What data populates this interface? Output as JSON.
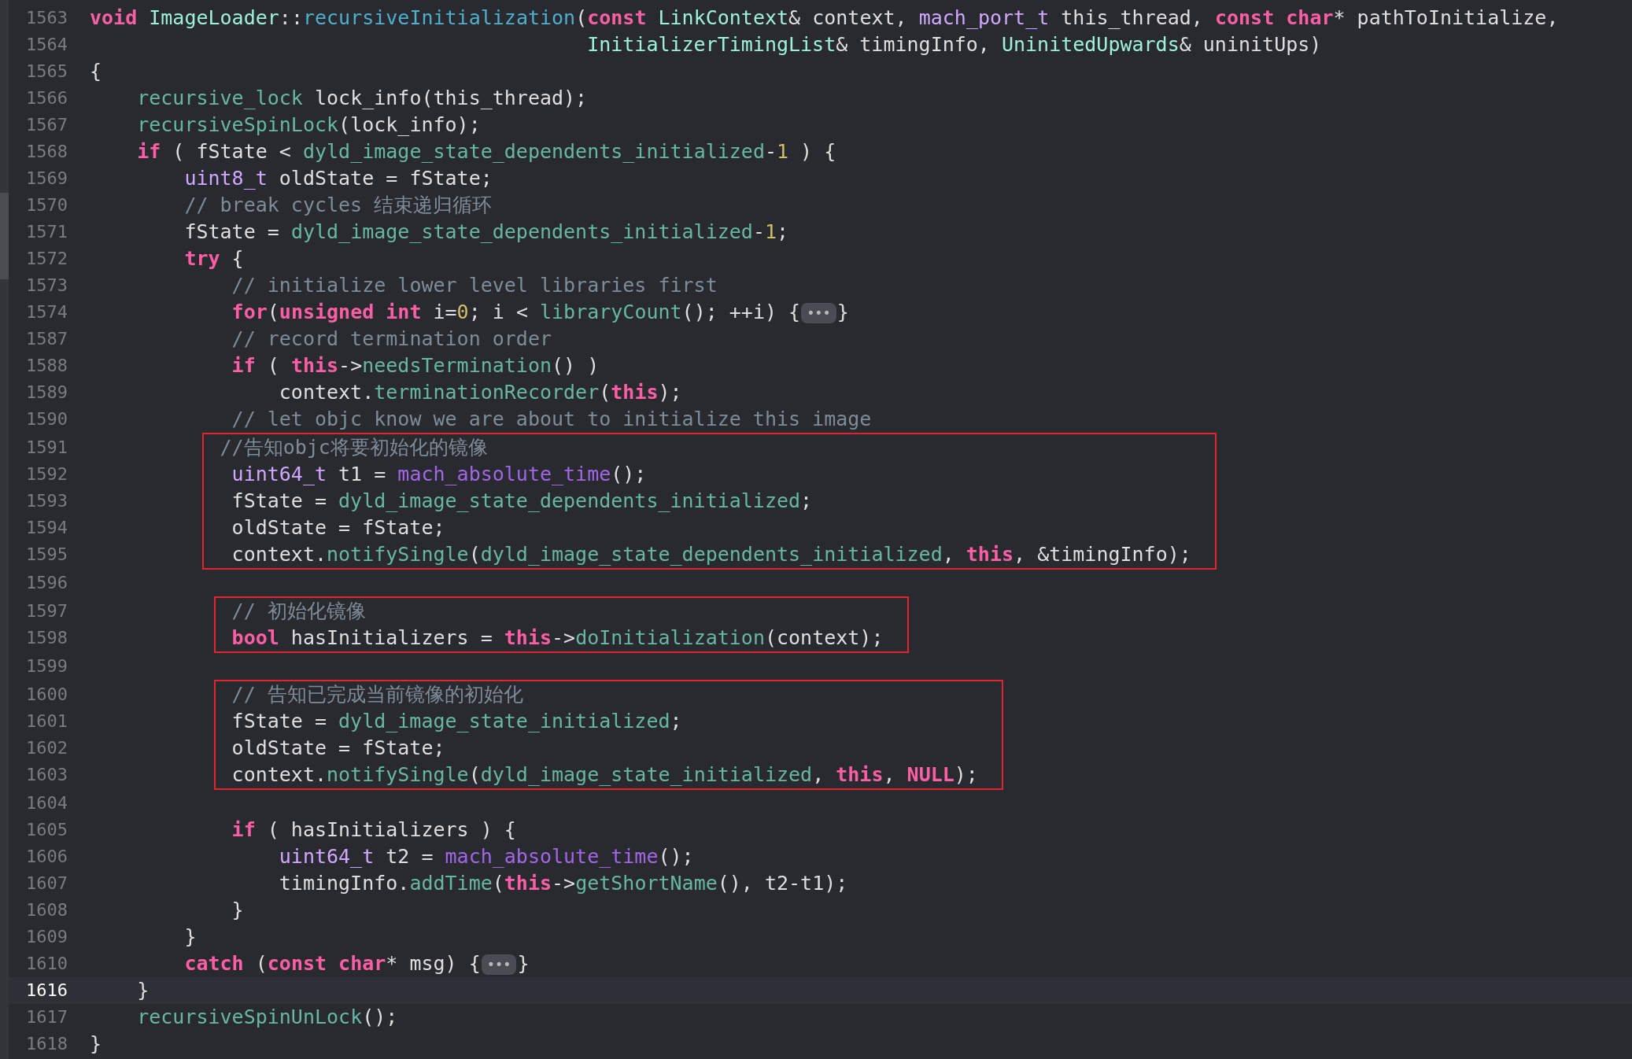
{
  "editor": {
    "blocks": [
      {
        "kind": "plain",
        "lines": [
          {
            "number": "1563",
            "current": false,
            "tokens": [
              {
                "kind": "keyword",
                "text": "void "
              },
              {
                "kind": "type",
                "text": "ImageLoader"
              },
              {
                "kind": "plain",
                "text": "::"
              },
              {
                "kind": "declaration",
                "text": "recursiveInitialization"
              },
              {
                "kind": "plain",
                "text": "("
              },
              {
                "kind": "keyword",
                "text": "const "
              },
              {
                "kind": "type",
                "text": "LinkContext"
              },
              {
                "kind": "plain",
                "text": "& context, "
              },
              {
                "kind": "systype",
                "text": "mach_port_t"
              },
              {
                "kind": "plain",
                "text": " this_thread, "
              },
              {
                "kind": "keyword",
                "text": "const "
              },
              {
                "kind": "keyword",
                "text": "char"
              },
              {
                "kind": "plain",
                "text": "* pathToInitialize,"
              }
            ]
          },
          {
            "number": "1564",
            "current": false,
            "tokens": [
              {
                "kind": "type",
                "text": "                                          InitializerTimingList"
              },
              {
                "kind": "plain",
                "text": "& timingInfo, "
              },
              {
                "kind": "type",
                "text": "UninitedUpwards"
              },
              {
                "kind": "plain",
                "text": "& uninitUps)"
              }
            ]
          },
          {
            "number": "1565",
            "current": false,
            "tokens": [
              {
                "kind": "plain",
                "text": "{"
              }
            ]
          },
          {
            "number": "1566",
            "current": false,
            "tokens": [
              {
                "kind": "function",
                "text": "    recursive_lock"
              },
              {
                "kind": "plain",
                "text": " lock_info(this_thread);"
              }
            ]
          },
          {
            "number": "1567",
            "current": false,
            "tokens": [
              {
                "kind": "function",
                "text": "    recursiveSpinLock"
              },
              {
                "kind": "plain",
                "text": "(lock_info);"
              }
            ]
          },
          {
            "number": "1568",
            "current": false,
            "tokens": [
              {
                "kind": "keyword",
                "text": "    if"
              },
              {
                "kind": "plain",
                "text": " ( fState < "
              },
              {
                "kind": "function",
                "text": "dyld_image_state_dependents_initialized"
              },
              {
                "kind": "plain",
                "text": "-"
              },
              {
                "kind": "number",
                "text": "1"
              },
              {
                "kind": "plain",
                "text": " ) {"
              }
            ]
          },
          {
            "number": "1569",
            "current": false,
            "tokens": [
              {
                "kind": "systype",
                "text": "        uint8_t"
              },
              {
                "kind": "plain",
                "text": " oldState = fState;"
              }
            ]
          },
          {
            "number": "1570",
            "current": false,
            "tokens": [
              {
                "kind": "comment",
                "text": "        // break cycles 结束递归循环"
              }
            ]
          },
          {
            "number": "1571",
            "current": false,
            "tokens": [
              {
                "kind": "plain",
                "text": "        fState = "
              },
              {
                "kind": "function",
                "text": "dyld_image_state_dependents_initialized"
              },
              {
                "kind": "plain",
                "text": "-"
              },
              {
                "kind": "number",
                "text": "1"
              },
              {
                "kind": "plain",
                "text": ";"
              }
            ]
          },
          {
            "number": "1572",
            "current": false,
            "tokens": [
              {
                "kind": "keyword",
                "text": "        try"
              },
              {
                "kind": "plain",
                "text": " {"
              }
            ]
          },
          {
            "number": "1573",
            "current": false,
            "tokens": [
              {
                "kind": "comment",
                "text": "            // initialize lower level libraries first"
              }
            ]
          },
          {
            "number": "1574",
            "current": false,
            "tokens": [
              {
                "kind": "keyword",
                "text": "            for"
              },
              {
                "kind": "plain",
                "text": "("
              },
              {
                "kind": "keyword",
                "text": "unsigned int"
              },
              {
                "kind": "plain",
                "text": " i="
              },
              {
                "kind": "number",
                "text": "0"
              },
              {
                "kind": "plain",
                "text": "; i < "
              },
              {
                "kind": "function",
                "text": "libraryCount"
              },
              {
                "kind": "plain",
                "text": "(); ++i) {"
              },
              {
                "kind": "fold",
                "text": "•••"
              },
              {
                "kind": "plain",
                "text": "}"
              }
            ]
          },
          {
            "number": "1587",
            "current": false,
            "tokens": [
              {
                "kind": "comment",
                "text": "            // record termination order"
              }
            ]
          },
          {
            "number": "1588",
            "current": false,
            "tokens": [
              {
                "kind": "keyword",
                "text": "            if"
              },
              {
                "kind": "plain",
                "text": " ( "
              },
              {
                "kind": "keyword",
                "text": "this"
              },
              {
                "kind": "plain",
                "text": "->"
              },
              {
                "kind": "function",
                "text": "needsTermination"
              },
              {
                "kind": "plain",
                "text": "() )"
              }
            ]
          },
          {
            "number": "1589",
            "current": false,
            "tokens": [
              {
                "kind": "plain",
                "text": "                context."
              },
              {
                "kind": "function",
                "text": "terminationRecorder"
              },
              {
                "kind": "plain",
                "text": "("
              },
              {
                "kind": "keyword",
                "text": "this"
              },
              {
                "kind": "plain",
                "text": ");"
              }
            ]
          },
          {
            "number": "1590",
            "current": false,
            "tokens": [
              {
                "kind": "comment",
                "text": "            // let objc know we are about to initialize this image"
              }
            ]
          }
        ]
      },
      {
        "kind": "boxed",
        "lines": [
          {
            "number": "1591",
            "current": false,
            "tokens": [
              {
                "kind": "comment",
                "text": "           //告知objc将要初始化的镜像"
              }
            ]
          },
          {
            "number": "1592",
            "current": false,
            "tokens": [
              {
                "kind": "systype",
                "text": "            uint64_t"
              },
              {
                "kind": "plain",
                "text": " t1 = "
              },
              {
                "kind": "sysfunction",
                "text": "mach_absolute_time"
              },
              {
                "kind": "plain",
                "text": "();"
              }
            ]
          },
          {
            "number": "1593",
            "current": false,
            "tokens": [
              {
                "kind": "plain",
                "text": "            fState = "
              },
              {
                "kind": "function",
                "text": "dyld_image_state_dependents_initialized"
              },
              {
                "kind": "plain",
                "text": ";"
              }
            ]
          },
          {
            "number": "1594",
            "current": false,
            "tokens": [
              {
                "kind": "plain",
                "text": "            oldState = fState;"
              }
            ]
          },
          {
            "number": "1595",
            "current": false,
            "tokens": [
              {
                "kind": "plain",
                "text": "            context."
              },
              {
                "kind": "function",
                "text": "notifySingle"
              },
              {
                "kind": "plain",
                "text": "("
              },
              {
                "kind": "function",
                "text": "dyld_image_state_dependents_initialized"
              },
              {
                "kind": "plain",
                "text": ", "
              },
              {
                "kind": "keyword",
                "text": "this"
              },
              {
                "kind": "plain",
                "text": ", &timingInfo);"
              }
            ]
          }
        ]
      },
      {
        "kind": "plain",
        "lines": [
          {
            "number": "1596",
            "current": false
          }
        ]
      },
      {
        "kind": "boxed",
        "lines": [
          {
            "number": "1597",
            "current": false,
            "tokens": [
              {
                "kind": "comment",
                "text": "            // 初始化镜像"
              }
            ]
          },
          {
            "number": "1598",
            "current": false,
            "tokens": [
              {
                "kind": "keyword",
                "text": "            bool"
              },
              {
                "kind": "plain",
                "text": " hasInitializers = "
              },
              {
                "kind": "keyword",
                "text": "this"
              },
              {
                "kind": "plain",
                "text": "->"
              },
              {
                "kind": "function",
                "text": "doInitialization"
              },
              {
                "kind": "plain",
                "text": "(context);"
              }
            ]
          }
        ]
      },
      {
        "kind": "plain",
        "lines": [
          {
            "number": "1599",
            "current": false
          }
        ]
      },
      {
        "kind": "boxed",
        "lines": [
          {
            "number": "1600",
            "current": false,
            "tokens": [
              {
                "kind": "comment",
                "text": "            // 告知已完成当前镜像的初始化"
              }
            ]
          },
          {
            "number": "1601",
            "current": false,
            "tokens": [
              {
                "kind": "plain",
                "text": "            fState = "
              },
              {
                "kind": "function",
                "text": "dyld_image_state_initialized"
              },
              {
                "kind": "plain",
                "text": ";"
              }
            ]
          },
          {
            "number": "1602",
            "current": false,
            "tokens": [
              {
                "kind": "plain",
                "text": "            oldState = fState;"
              }
            ]
          },
          {
            "number": "1603",
            "current": false,
            "tokens": [
              {
                "kind": "plain",
                "text": "            context."
              },
              {
                "kind": "function",
                "text": "notifySingle"
              },
              {
                "kind": "plain",
                "text": "("
              },
              {
                "kind": "function",
                "text": "dyld_image_state_initialized"
              },
              {
                "kind": "plain",
                "text": ", "
              },
              {
                "kind": "keyword",
                "text": "this"
              },
              {
                "kind": "plain",
                "text": ", "
              },
              {
                "kind": "keyword",
                "text": "NULL"
              },
              {
                "kind": "plain",
                "text": ");"
              }
            ]
          }
        ]
      },
      {
        "kind": "plain",
        "lines": [
          {
            "number": "1604",
            "current": false
          },
          {
            "number": "1605",
            "current": false,
            "tokens": [
              {
                "kind": "keyword",
                "text": "            if"
              },
              {
                "kind": "plain",
                "text": " ( hasInitializers ) {"
              }
            ]
          },
          {
            "number": "1606",
            "current": false,
            "tokens": [
              {
                "kind": "systype",
                "text": "                uint64_t"
              },
              {
                "kind": "plain",
                "text": " t2 = "
              },
              {
                "kind": "sysfunction",
                "text": "mach_absolute_time"
              },
              {
                "kind": "plain",
                "text": "();"
              }
            ]
          },
          {
            "number": "1607",
            "current": false,
            "tokens": [
              {
                "kind": "plain",
                "text": "                timingInfo."
              },
              {
                "kind": "function",
                "text": "addTime"
              },
              {
                "kind": "plain",
                "text": "("
              },
              {
                "kind": "keyword",
                "text": "this"
              },
              {
                "kind": "plain",
                "text": "->"
              },
              {
                "kind": "function",
                "text": "getShortName"
              },
              {
                "kind": "plain",
                "text": "(), t2-t1);"
              }
            ]
          },
          {
            "number": "1608",
            "current": false,
            "tokens": [
              {
                "kind": "plain",
                "text": "            }"
              }
            ]
          },
          {
            "number": "1609",
            "current": false,
            "tokens": [
              {
                "kind": "plain",
                "text": "        }"
              }
            ]
          },
          {
            "number": "1610",
            "current": false,
            "tokens": [
              {
                "kind": "keyword",
                "text": "        catch"
              },
              {
                "kind": "plain",
                "text": " ("
              },
              {
                "kind": "keyword",
                "text": "const char"
              },
              {
                "kind": "plain",
                "text": "* msg) {"
              },
              {
                "kind": "fold",
                "text": "•••"
              },
              {
                "kind": "plain",
                "text": "}"
              }
            ]
          },
          {
            "number": "1616",
            "current": true,
            "tokens": [
              {
                "kind": "plain",
                "text": "    }"
              }
            ]
          },
          {
            "number": "1617",
            "current": false,
            "tokens": [
              {
                "kind": "function",
                "text": "    recursiveSpinUnLock"
              },
              {
                "kind": "plain",
                "text": "();"
              }
            ]
          },
          {
            "number": "1618",
            "current": false,
            "tokens": [
              {
                "kind": "plain",
                "text": "}"
              }
            ]
          }
        ]
      }
    ]
  }
}
